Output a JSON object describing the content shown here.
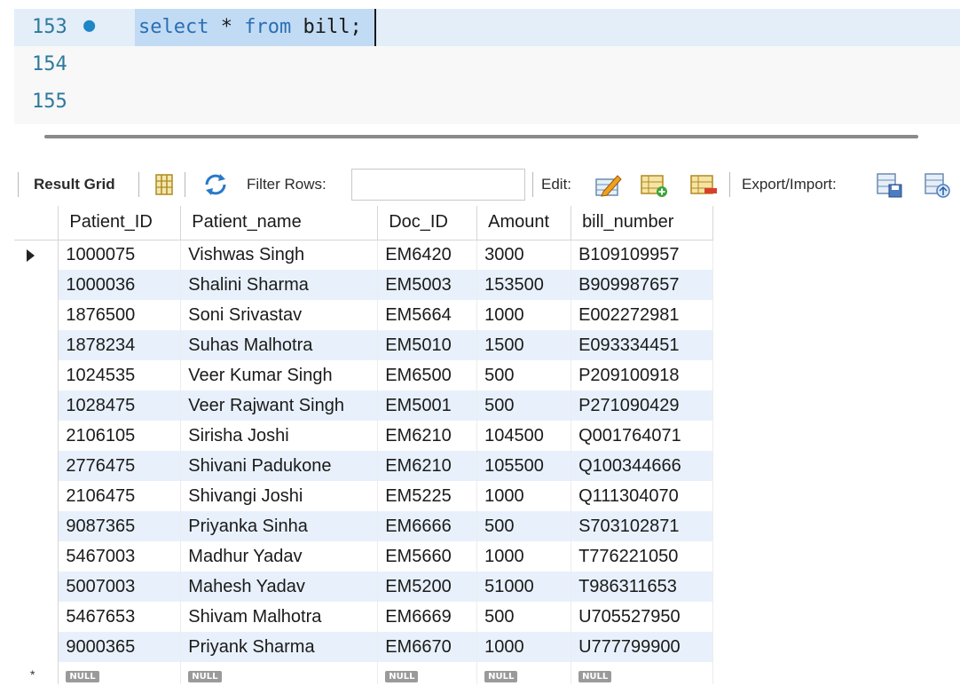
{
  "editor": {
    "lines": [
      {
        "number": "153",
        "code_keyword1": "select",
        "code_star": " * ",
        "code_keyword2": "from",
        "code_rest": " bill;"
      },
      {
        "number": "154"
      },
      {
        "number": "155"
      }
    ],
    "exec_marker": "●"
  },
  "toolbar": {
    "result_grid_label": "Result Grid",
    "filter_rows_label": "Filter Rows:",
    "filter_value": "",
    "edit_label": "Edit:",
    "export_import_label": "Export/Import:"
  },
  "grid": {
    "columns": [
      "Patient_ID",
      "Patient_name",
      "Doc_ID",
      "Amount",
      "bill_number"
    ],
    "rows": [
      [
        "1000075",
        "Vishwas Singh",
        "EM6420",
        "3000",
        "B109109957"
      ],
      [
        "1000036",
        "Shalini Sharma",
        "EM5003",
        "153500",
        "B909987657"
      ],
      [
        "1876500",
        "Soni Srivastav",
        "EM5664",
        "1000",
        "E002272981"
      ],
      [
        "1878234",
        "Suhas Malhotra",
        "EM5010",
        "1500",
        "E093334451"
      ],
      [
        "1024535",
        "Veer Kumar Singh",
        "EM6500",
        "500",
        "P209100918"
      ],
      [
        "1028475",
        "Veer Rajwant Singh",
        "EM5001",
        "500",
        "P271090429"
      ],
      [
        "2106105",
        "Sirisha Joshi",
        "EM6210",
        "104500",
        "Q001764071"
      ],
      [
        "2776475",
        "Shivani Padukone",
        "EM6210",
        "105500",
        "Q100344666"
      ],
      [
        "2106475",
        "Shivangi Joshi",
        "EM5225",
        "1000",
        "Q111304070"
      ],
      [
        "9087365",
        "Priyanka Sinha",
        "EM6666",
        "500",
        "S703102871"
      ],
      [
        "5467003",
        "Madhur Yadav",
        "EM5660",
        "1000",
        "T776221050"
      ],
      [
        "5007003",
        "Mahesh Yadav",
        "EM5200",
        "51000",
        "T986311653"
      ],
      [
        "5467653",
        "Shivam Malhotra",
        "EM6669",
        "500",
        "U705527950"
      ],
      [
        "9000365",
        "Priyank Sharma",
        "EM6670",
        "1000",
        "U777799900"
      ]
    ],
    "null_label": "NULL",
    "new_row_marker": "*"
  }
}
